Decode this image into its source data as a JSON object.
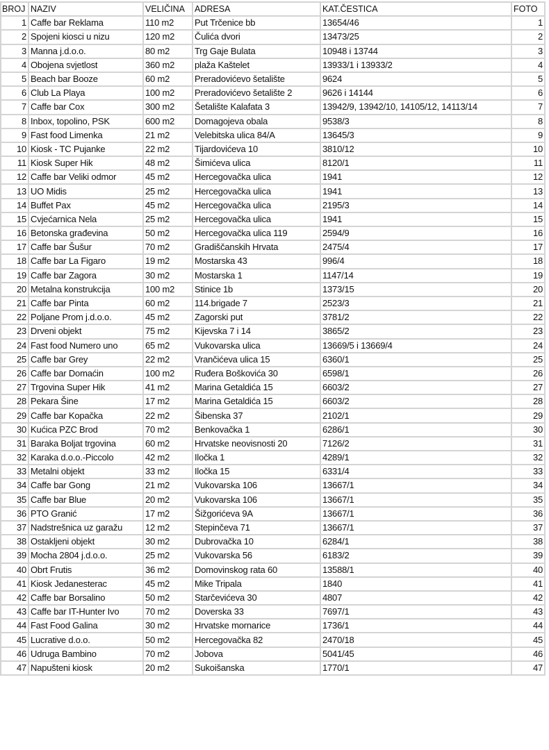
{
  "headers": [
    "BROJ",
    "NAZIV",
    "VELIČINA",
    "ADRESA",
    "KAT.ČESTICA",
    "FOTO"
  ],
  "rows": [
    [
      "1",
      "Caffe bar Reklama",
      "110 m2",
      "Put Trčenice bb",
      "13654/46",
      "1"
    ],
    [
      "2",
      "Spojeni kiosci u nizu",
      "120 m2",
      "Čulića dvori",
      "13473/25",
      "2"
    ],
    [
      "3",
      "Manna j.d.o.o.",
      "80 m2",
      "Trg Gaje Bulata",
      "10948 i 13744",
      "3"
    ],
    [
      "4",
      "Obojena svjetlost",
      "360 m2",
      "plaža Kaštelet",
      "13933/1 i 13933/2",
      "4"
    ],
    [
      "5",
      "Beach bar Booze",
      "60 m2",
      "Preradovićevo šetalište",
      "9624",
      "5"
    ],
    [
      "6",
      "Club La Playa",
      "100 m2",
      "Preradovićevo šetalište 2",
      "9626 i 14144",
      "6"
    ],
    [
      "7",
      "Caffe bar Cox",
      "300 m2",
      "Šetalište Kalafata 3",
      "13942/9, 13942/10, 14105/12, 14113/14",
      "7"
    ],
    [
      "8",
      "Inbox, topolino, PSK",
      "600 m2",
      "Domagojeva obala",
      "9538/3",
      "8"
    ],
    [
      "9",
      "Fast food Limenka",
      "21 m2",
      "Velebitska ulica 84/A",
      "13645/3",
      "9"
    ],
    [
      "10",
      "Kiosk - TC Pujanke",
      "22 m2",
      "Tijardovićeva 10",
      "3810/12",
      "10"
    ],
    [
      "11",
      "Kiosk Super Hik",
      "48 m2",
      "Šimićeva ulica",
      "8120/1",
      "11"
    ],
    [
      "12",
      "Caffe bar Veliki odmor",
      "45 m2",
      "Hercegovačka ulica",
      "1941",
      "12"
    ],
    [
      "13",
      "UO Midis",
      "25 m2",
      "Hercegovačka ulica",
      "1941",
      "13"
    ],
    [
      "14",
      "Buffet Pax",
      "45 m2",
      "Hercegovačka ulica",
      "2195/3",
      "14"
    ],
    [
      "15",
      "Cvjećarnica Nela",
      "25 m2",
      "Hercegovačka ulica",
      "1941",
      "15"
    ],
    [
      "16",
      "Betonska građevina",
      "50 m2",
      "Hercegovačka ulica 119",
      "2594/9",
      "16"
    ],
    [
      "17",
      "Caffe bar Šušur",
      "70 m2",
      "Gradiščanskih Hrvata",
      "2475/4",
      "17"
    ],
    [
      "18",
      "Caffe bar La Figaro",
      "19 m2",
      "Mostarska 43",
      "996/4",
      "18"
    ],
    [
      "19",
      "Caffe bar Zagora",
      "30 m2",
      "Mostarska 1",
      "1147/14",
      "19"
    ],
    [
      "20",
      "Metalna konstrukcija",
      "100 m2",
      "Stinice 1b",
      "1373/15",
      "20"
    ],
    [
      "21",
      "Caffe bar Pinta",
      "60 m2",
      "114.brigade 7",
      "2523/3",
      "21"
    ],
    [
      "22",
      "Poljane Prom j.d.o.o.",
      "45 m2",
      "Zagorski put",
      "3781/2",
      "22"
    ],
    [
      "23",
      "Drveni objekt",
      "75 m2",
      "Kijevska 7 i 14",
      "3865/2",
      "23"
    ],
    [
      "24",
      "Fast food Numero uno",
      "65 m2",
      "Vukovarska ulica",
      "13669/5 i 13669/4",
      "24"
    ],
    [
      "25",
      "Caffe bar Grey",
      "22 m2",
      "Vrančićeva ulica 15",
      "6360/1",
      "25"
    ],
    [
      "26",
      "Caffe bar Domaćin",
      "100 m2",
      "Ruđera Boškovića 30",
      "6598/1",
      "26"
    ],
    [
      "27",
      "Trgovina Super Hik",
      "41 m2",
      "Marina Getaldića 15",
      "6603/2",
      "27"
    ],
    [
      "28",
      "Pekara Šine",
      "17 m2",
      "Marina Getaldića 15",
      "6603/2",
      "28"
    ],
    [
      "29",
      "Caffe bar Kopačka",
      "22 m2",
      "Šibenska 37",
      "2102/1",
      "29"
    ],
    [
      "30",
      "Kućica PZC Brod",
      "70 m2",
      "Benkovačka 1",
      "6286/1",
      "30"
    ],
    [
      "31",
      "Baraka Boljat trgovina",
      "60 m2",
      "Hrvatske neovisnosti 20",
      "7126/2",
      "31"
    ],
    [
      "32",
      "Karaka d.o.o.-Piccolo",
      "42 m2",
      "Iločka 1",
      "4289/1",
      "32"
    ],
    [
      "33",
      "Metalni objekt",
      "33 m2",
      "Iločka 15",
      "6331/4",
      "33"
    ],
    [
      "34",
      "Caffe bar Gong",
      "21 m2",
      "Vukovarska 106",
      "13667/1",
      "34"
    ],
    [
      "35",
      "Caffe bar Blue",
      "20 m2",
      "Vukovarska 106",
      "13667/1",
      "35"
    ],
    [
      "36",
      "PTO Granić",
      "17 m2",
      "Šižgorićeva 9A",
      "13667/1",
      "36"
    ],
    [
      "37",
      "Nadstrešnica uz garažu",
      "12 m2",
      "Stepinčeva 71",
      "13667/1",
      "37"
    ],
    [
      "38",
      "Ostakljeni objekt",
      "30 m2",
      "Dubrovačka 10",
      "6284/1",
      "38"
    ],
    [
      "39",
      "Mocha 2804 j.d.o.o.",
      "25 m2",
      "Vukovarska 56",
      "6183/2",
      "39"
    ],
    [
      "40",
      "Obrt Frutis",
      "36 m2",
      "Domovinskog rata 60",
      "13588/1",
      "40"
    ],
    [
      "41",
      "Kiosk Jedanesterac",
      "45 m2",
      "Mike Tripala",
      "1840",
      "41"
    ],
    [
      "42",
      "Caffe bar Borsalino",
      "50 m2",
      "Starčevićeva 30",
      "4807",
      "42"
    ],
    [
      "43",
      "Caffe bar IT-Hunter Ivo",
      "70 m2",
      "Doverska 33",
      "7697/1",
      "43"
    ],
    [
      "44",
      "Fast Food Galina",
      "30 m2",
      "Hrvatske mornarice",
      "1736/1",
      "44"
    ],
    [
      "45",
      "Lucrative d.o.o.",
      "50 m2",
      "Hercegovačka 82",
      "2470/18",
      "45"
    ],
    [
      "46",
      "Udruga Bambino",
      "70 m2",
      "Jobova",
      "5041/45",
      "46"
    ],
    [
      "47",
      "Napušteni kiosk",
      "20 m2",
      "Sukoišanska",
      "1770/1",
      "47"
    ]
  ]
}
